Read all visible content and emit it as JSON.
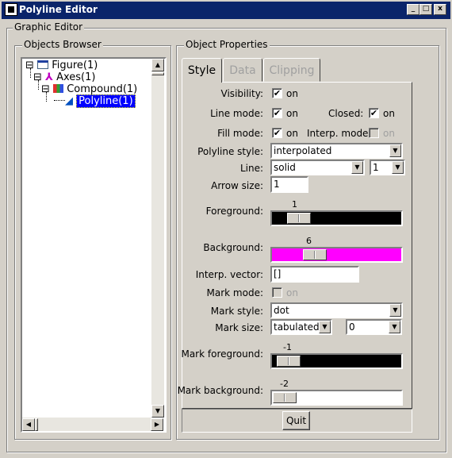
{
  "window": {
    "title": "Polyline Editor",
    "min": "_",
    "max": "□",
    "close": "x"
  },
  "graphic_editor": {
    "label": "Graphic Editor"
  },
  "objects_browser": {
    "label": "Objects Browser",
    "tree": [
      {
        "label": "Figure(1)",
        "expander": "⊟"
      },
      {
        "label": "Axes(1)",
        "expander": "⊟"
      },
      {
        "label": "Compound(1)",
        "expander": "⊟"
      },
      {
        "label": "Polyline(1)",
        "selected": true
      }
    ]
  },
  "object_properties": {
    "label": "Object Properties",
    "tabs": [
      {
        "label": "Style",
        "active": true
      },
      {
        "label": "Data",
        "active": false
      },
      {
        "label": "Clipping",
        "active": false
      }
    ]
  },
  "style": {
    "visibility": {
      "label": "Visibility:",
      "checked": "✔",
      "on": "on"
    },
    "line_mode": {
      "label": "Line mode:",
      "checked": "✔",
      "on": "on"
    },
    "closed": {
      "label": "Closed:",
      "checked": "✔",
      "on": "on"
    },
    "fill_mode": {
      "label": "Fill mode:",
      "checked": "✔",
      "on": "on"
    },
    "interp_mode": {
      "label": "Interp. mode:",
      "on": "on",
      "enabled": false
    },
    "polyline_style": {
      "label": "Polyline style:",
      "value": "interpolated"
    },
    "line": {
      "label": "Line:",
      "style": "solid",
      "width": "1"
    },
    "arrow_size": {
      "label": "Arrow size:",
      "value": "1"
    },
    "foreground": {
      "label": "Foreground:",
      "value": "1",
      "color": "#000000",
      "level": 0.14
    },
    "background": {
      "label": "Background:",
      "value": "6",
      "color": "#ff00ff",
      "level": 0.29
    },
    "interp_vector": {
      "label": "Interp. vector:",
      "value": "[]"
    },
    "mark_mode": {
      "label": "Mark mode:",
      "on": "on",
      "enabled": false
    },
    "mark_style": {
      "label": "Mark style:",
      "value": "dot"
    },
    "mark_size": {
      "label": "Mark size:",
      "unit": "tabulated",
      "value": "0"
    },
    "mark_foreground": {
      "label": "Mark foreground:",
      "value": "-1",
      "color": "#000000",
      "level": 0.04
    },
    "mark_background": {
      "label": "Mark background:",
      "value": "-2",
      "color": "#ffffff",
      "level": 0.0
    }
  },
  "quit": {
    "label": "Quit"
  },
  "colors": {
    "titlebar": "#0a246a",
    "selection": "#0000ff",
    "face": "#d4d0c8"
  }
}
